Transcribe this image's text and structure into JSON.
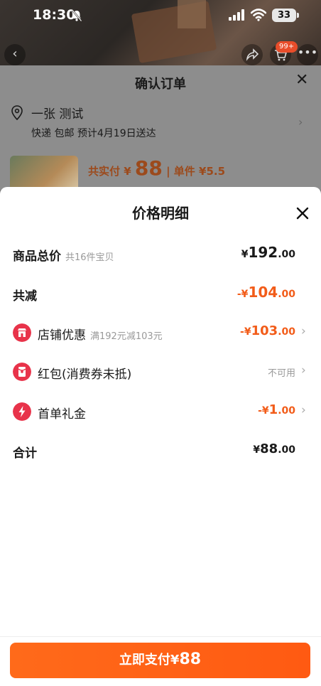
{
  "status": {
    "time": "18:30",
    "battery": "33"
  },
  "nav": {
    "cart_badge": "99+"
  },
  "order": {
    "title": "确认订单",
    "address_name": "一张 测试",
    "delivery": "快递 包邮 预计4月19日送达",
    "paid_label": "共实付 ¥",
    "paid_amount": "88",
    "unit_label": "| 单件 ¥5.5"
  },
  "modal": {
    "title": "价格明细",
    "rows": [
      {
        "label": "商品总价",
        "sub": "共16件宝贝",
        "yen": "¥",
        "int": "192",
        "dec": ".00"
      },
      {
        "label": "共减",
        "sub": "",
        "yen": "-¥",
        "int": "104",
        "dec": ".00"
      },
      {
        "label": "店铺优惠",
        "sub": "满192元减103元",
        "yen": "-¥",
        "int": "103",
        "dec": ".00"
      },
      {
        "label": "红包(消费券未抵)",
        "sub": "",
        "value": "不可用"
      },
      {
        "label": "首单礼金",
        "sub": "",
        "yen": "-¥",
        "int": "1",
        "dec": ".00"
      },
      {
        "label": "合计",
        "sub": "",
        "yen": "¥",
        "int": "88",
        "dec": ".00"
      }
    ]
  },
  "pay": {
    "label": "立即支付",
    "yen": "¥",
    "amount": "88"
  },
  "colors": {
    "accent": "#ff5a12",
    "discount": "#f25c19",
    "shop_icon": "#e8334a",
    "redpacket_icon": "#e8334a"
  }
}
